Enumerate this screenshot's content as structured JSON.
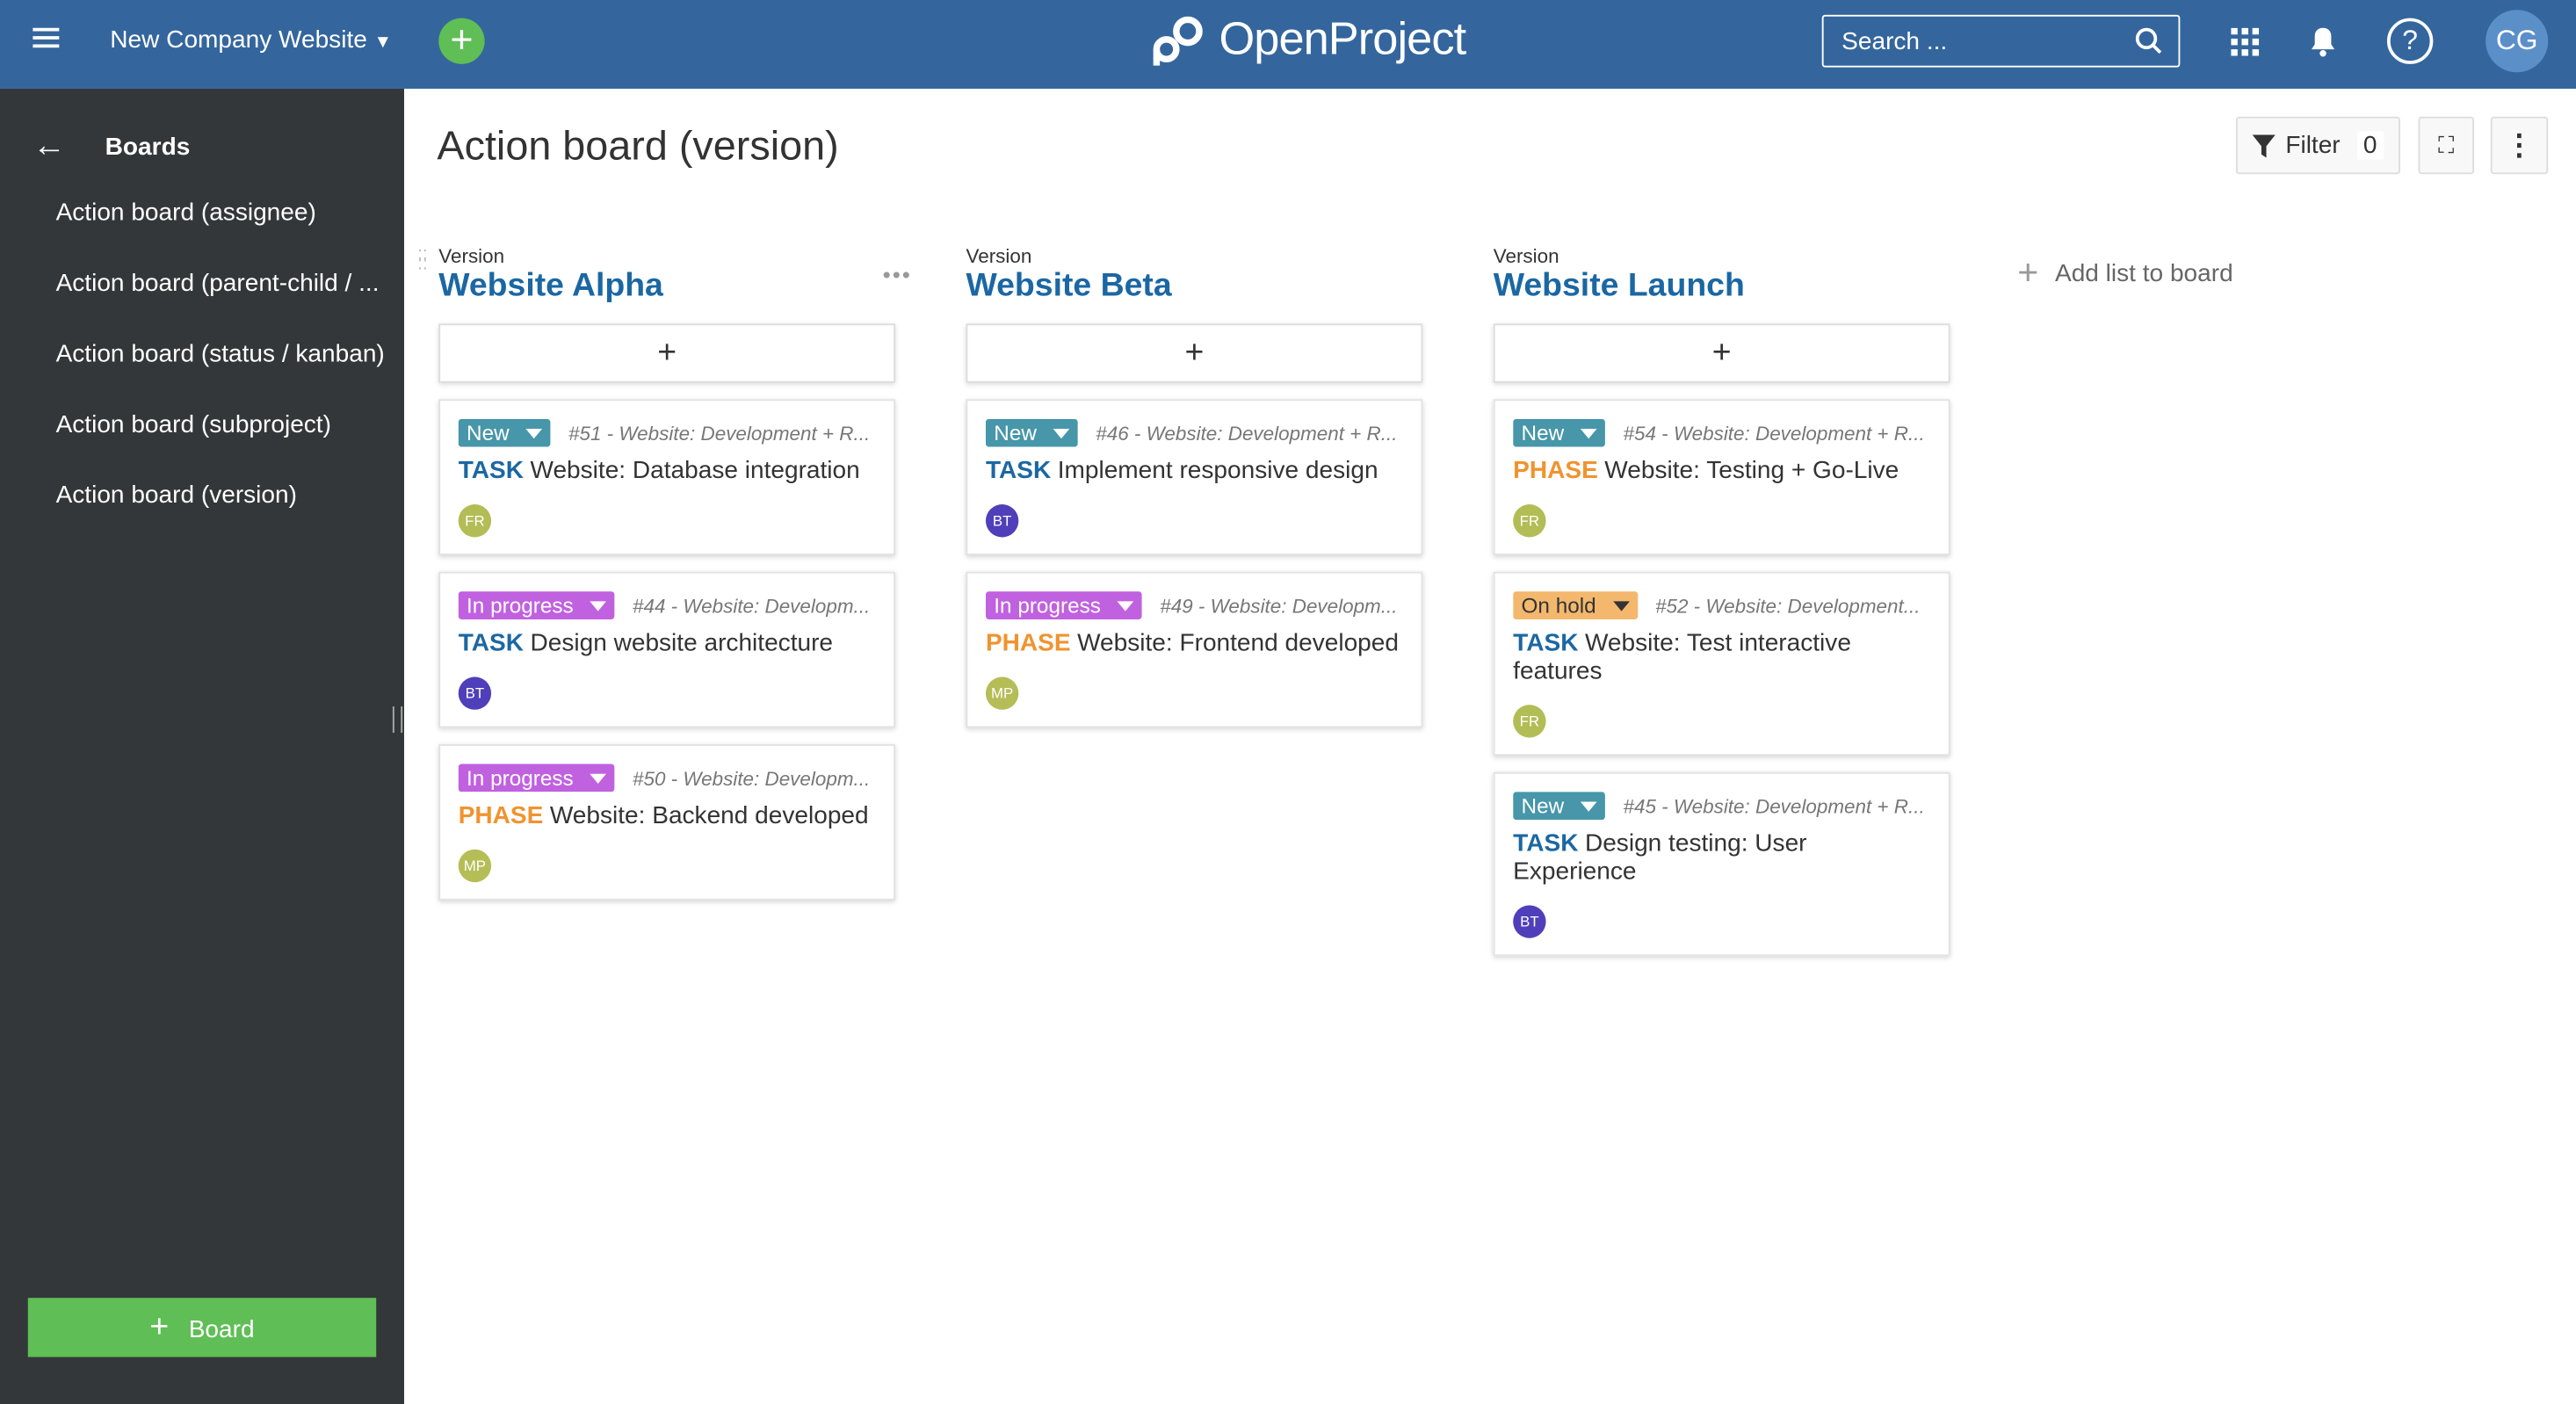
{
  "header": {
    "project": "New Company Website",
    "logo": "OpenProject",
    "search_placeholder": "Search ...",
    "user_initials": "CG"
  },
  "sidebar": {
    "title": "Boards",
    "items": [
      "Action board (assignee)",
      "Action board (parent-child / ...",
      "Action board (status / kanban)",
      "Action board (subproject)",
      "Action board (version)"
    ],
    "add_board": "Board"
  },
  "main": {
    "title": "Action board (version)",
    "filter_label": "Filter",
    "filter_count": "0",
    "add_list": "Add list to board",
    "columns": [
      {
        "label": "Version",
        "name": "Website Alpha",
        "add": "+",
        "cards": [
          {
            "status": "New",
            "status_color": "#4796a9",
            "meta": "#51  - Website: Development + R...",
            "type": "TASK",
            "subject": "Website: Database integration",
            "assignee": "FR",
            "assignee_color": "#b2bd55"
          },
          {
            "status": "In progress",
            "status_color": "#c061e0",
            "meta": "#44  - Website: Developm...",
            "type": "TASK",
            "subject": "Design website architecture",
            "assignee": "BT",
            "assignee_color": "#4f3fba"
          },
          {
            "status": "In progress",
            "status_color": "#c061e0",
            "meta": "#50  - Website: Developm...",
            "type": "PHASE",
            "subject": "Website: Backend developed",
            "assignee": "MP",
            "assignee_color": "#b5bd57"
          }
        ]
      },
      {
        "label": "Version",
        "name": "Website Beta",
        "add": "+",
        "cards": [
          {
            "status": "New",
            "status_color": "#4796a9",
            "meta": "#46  - Website: Development + R...",
            "type": "TASK",
            "subject": "Implement responsive design",
            "assignee": "BT",
            "assignee_color": "#4f3fba"
          },
          {
            "status": "In progress",
            "status_color": "#c061e0",
            "meta": "#49  - Website: Developm...",
            "type": "PHASE",
            "subject": "Website: Frontend developed",
            "assignee": "MP",
            "assignee_color": "#b5bd57"
          }
        ]
      },
      {
        "label": "Version",
        "name": "Website Launch",
        "add": "+",
        "cards": [
          {
            "status": "New",
            "status_color": "#4796a9",
            "meta": "#54  - Website: Development + R...",
            "type": "PHASE",
            "subject": "Website: Testing + Go-Live",
            "assignee": "FR",
            "assignee_color": "#b2bd55"
          },
          {
            "status": "On hold",
            "status_color": "#f3b86e",
            "meta": "#52  - Website: Development...",
            "type": "TASK",
            "subject": "Website: Test interactive features",
            "assignee": "FR",
            "assignee_color": "#b2bd55"
          },
          {
            "status": "New",
            "status_color": "#4796a9",
            "meta": "#45  - Website: Development + R...",
            "type": "TASK",
            "subject": "Design testing: User Experience",
            "assignee": "BT",
            "assignee_color": "#4f3fba"
          }
        ]
      }
    ]
  },
  "colors": {
    "header": "#34669d",
    "sidebar": "#333739",
    "accent_green": "#5fbe55",
    "task": "#1b67a3",
    "phase": "#f0932f"
  }
}
